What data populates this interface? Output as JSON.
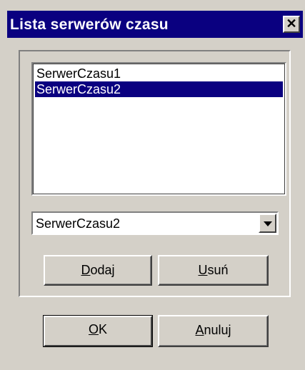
{
  "window": {
    "title": "Lista serwerów czasu",
    "close_glyph": "✕"
  },
  "list": {
    "items": [
      {
        "label": "SerwerCzasu1",
        "selected": false
      },
      {
        "label": "SerwerCzasu2",
        "selected": true
      }
    ]
  },
  "combo": {
    "value": "SerwerCzasu2",
    "arrow_icon": "chevron-down-icon"
  },
  "buttons": {
    "add": {
      "mnemonic": "D",
      "rest": "odaj"
    },
    "remove": {
      "mnemonic": "U",
      "rest": "suń"
    },
    "ok": {
      "mnemonic": "O",
      "rest": "K"
    },
    "cancel": {
      "mnemonic": "A",
      "rest": "nuluj"
    }
  },
  "colors": {
    "titlebar": "#0a0080",
    "selection": "#0a0080",
    "face": "#d4d0c8"
  }
}
